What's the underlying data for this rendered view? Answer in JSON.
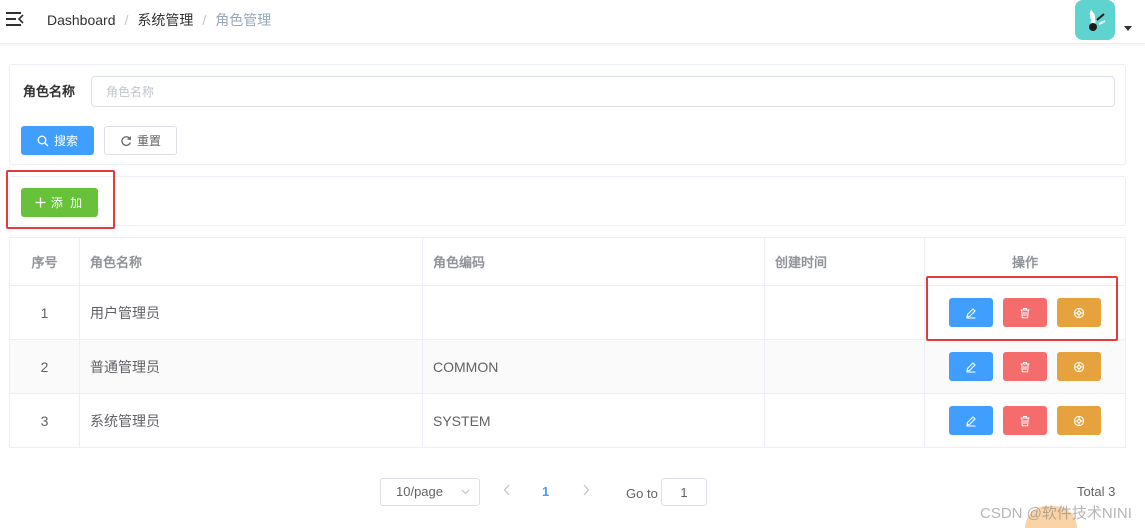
{
  "breadcrumb": {
    "items": [
      "Dashboard",
      "系统管理",
      "角色管理"
    ],
    "separator": "/"
  },
  "search": {
    "label": "角色名称",
    "placeholder": "角色名称",
    "value": "",
    "search_button": "搜索",
    "reset_button": "重置"
  },
  "toolbar": {
    "add_button": "添 加"
  },
  "table": {
    "columns": [
      "序号",
      "角色名称",
      "角色编码",
      "创建时间",
      "操作"
    ],
    "rows": [
      {
        "index": "1",
        "name": "用户管理员",
        "code": "",
        "created": ""
      },
      {
        "index": "2",
        "name": "普通管理员",
        "code": "COMMON",
        "created": ""
      },
      {
        "index": "3",
        "name": "系统管理员",
        "code": "SYSTEM",
        "created": ""
      }
    ]
  },
  "pagination": {
    "page_size": "10/page",
    "current_page": "1",
    "goto_label": "Go to",
    "goto_value": "1",
    "total": "Total 3"
  },
  "watermark": "CSDN @软件技术NINI",
  "icons": {
    "menu": "hamburger-icon",
    "search": "search-icon",
    "reset": "refresh-icon",
    "add": "plus-icon",
    "edit": "edit-icon",
    "delete": "delete-icon",
    "permission": "settings-icon",
    "prev": "chevron-left-icon",
    "next": "chevron-right-icon",
    "dropdown": "chevron-down-icon"
  },
  "colors": {
    "primary": "#409eff",
    "success": "#67c23a",
    "danger": "#f56c6c",
    "warning": "#e6a23c",
    "highlight": "#e33a3a",
    "avatar": "#5ed3d0"
  }
}
